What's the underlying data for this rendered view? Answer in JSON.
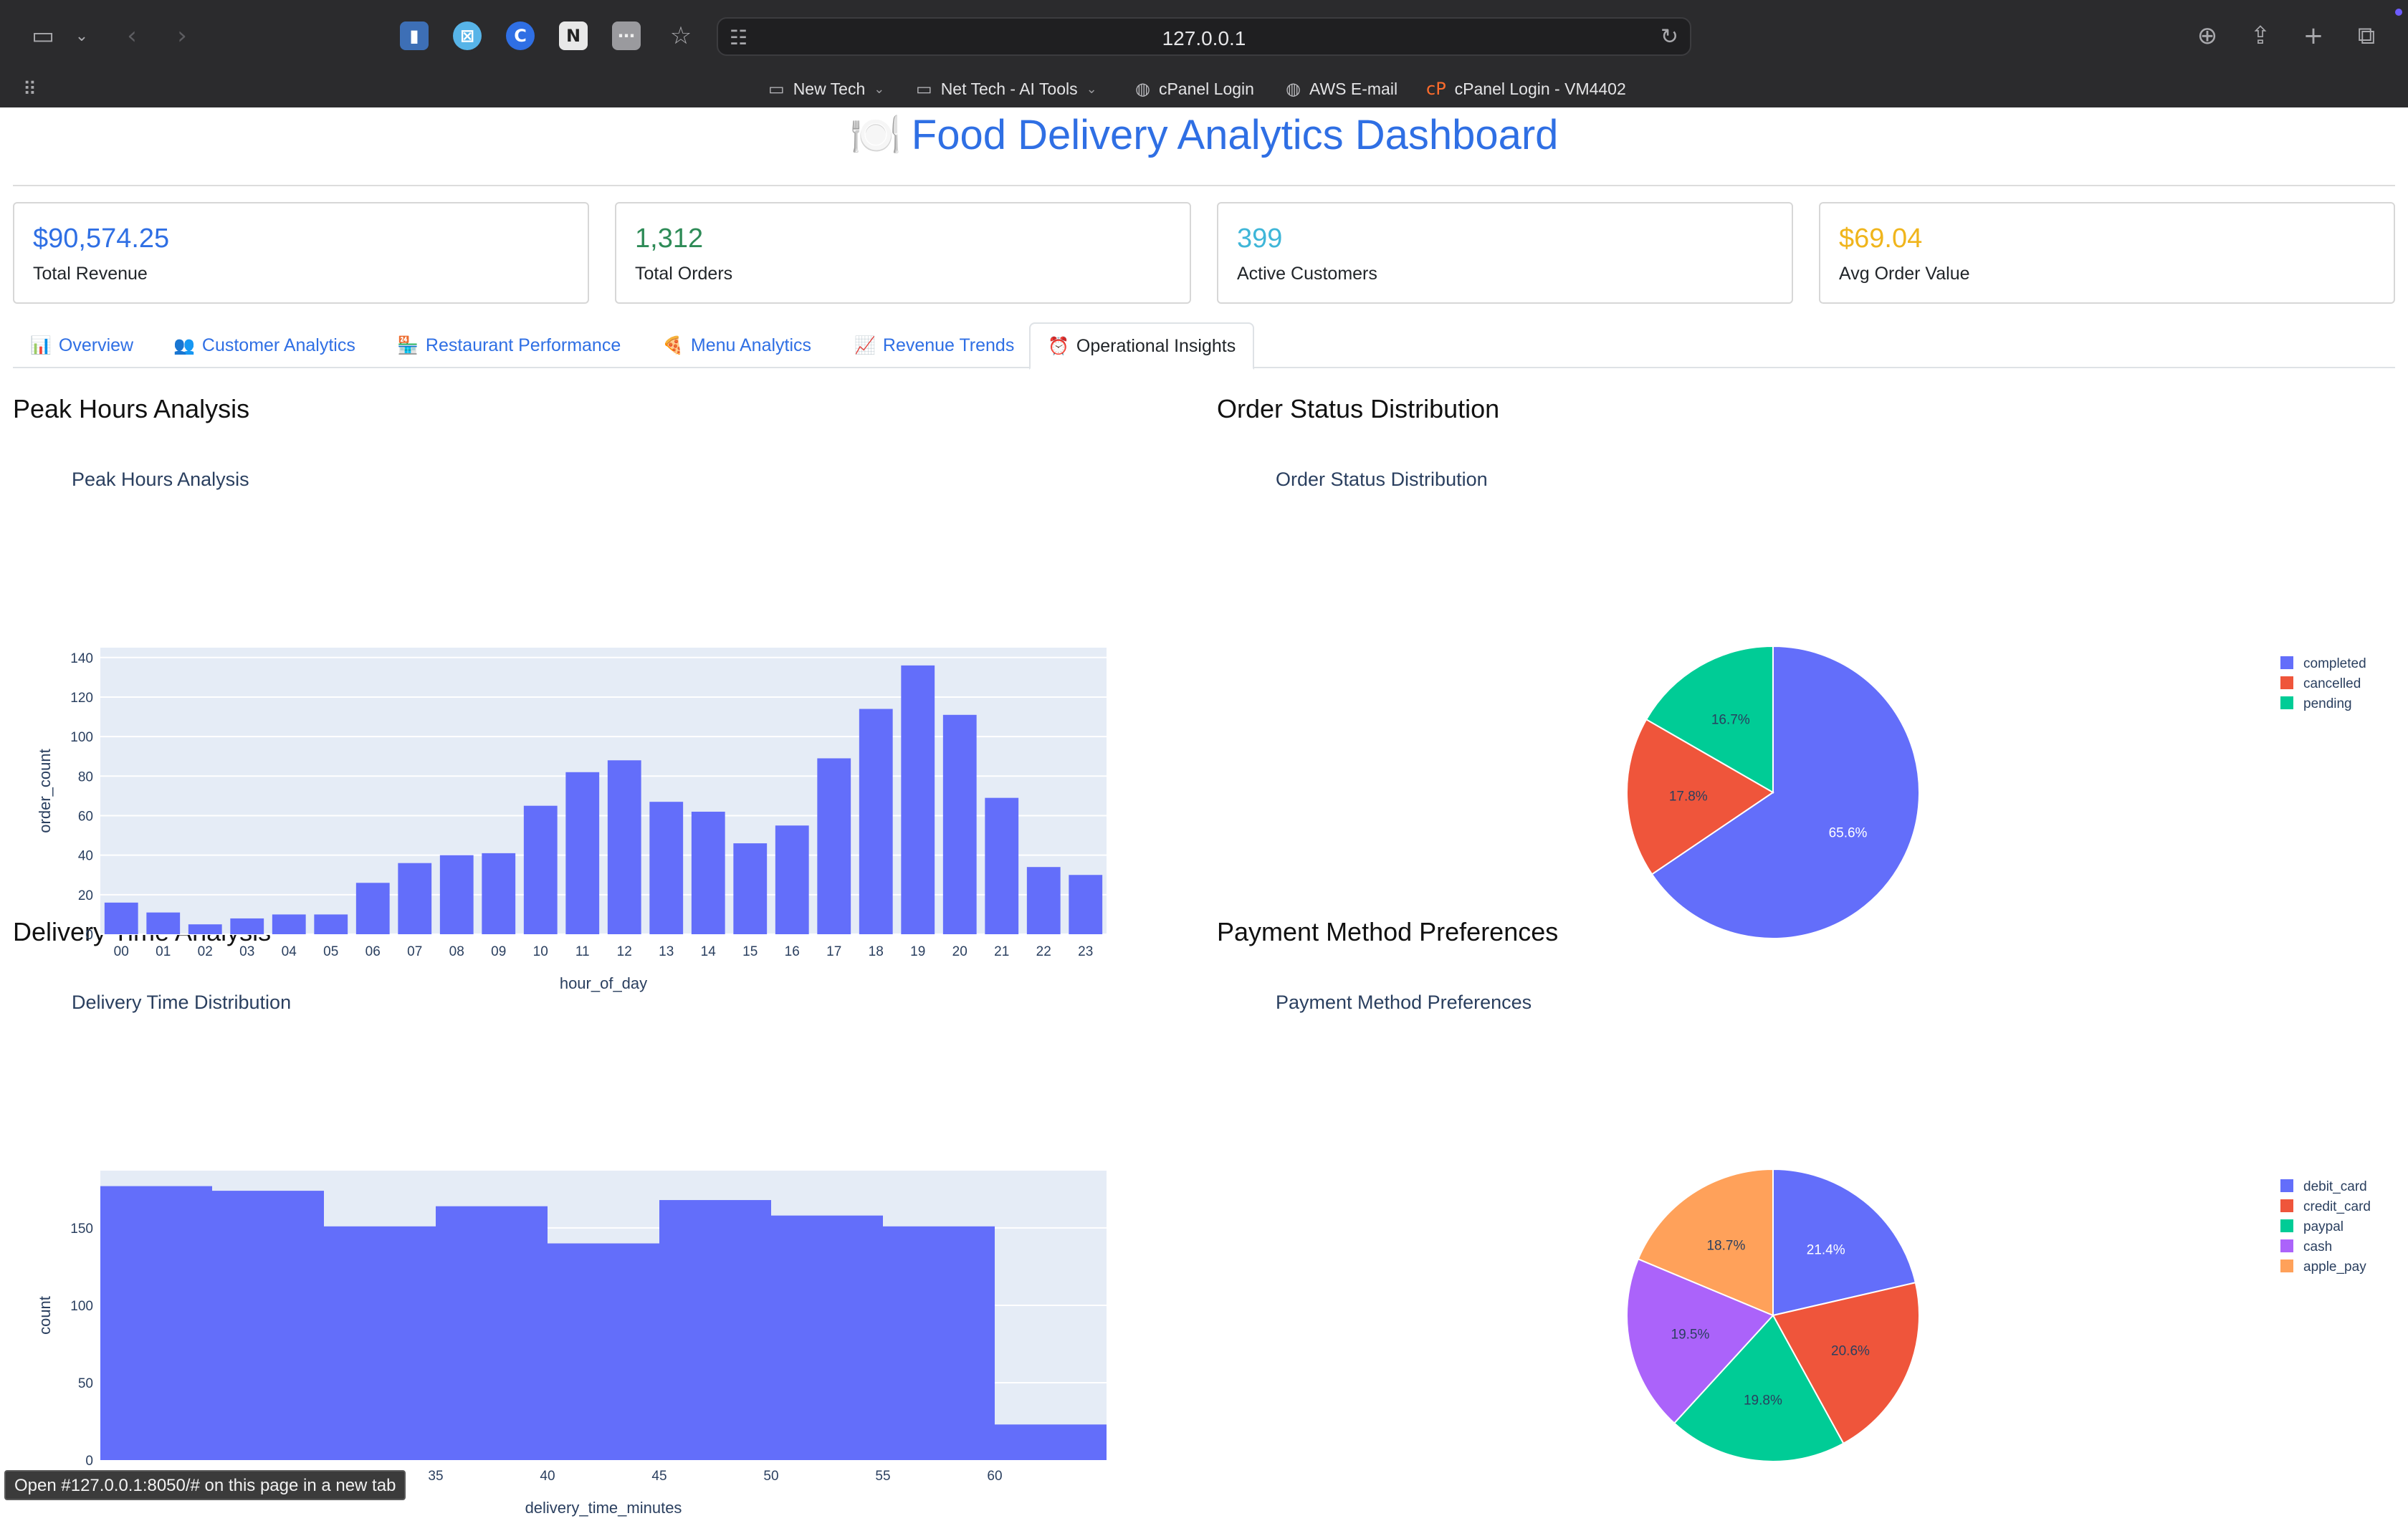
{
  "browser": {
    "url": "127.0.0.1",
    "bookmarks": [
      {
        "label": "New Tech",
        "icon": "folder-icon",
        "has_menu": true
      },
      {
        "label": "Net Tech - AI Tools",
        "icon": "folder-icon",
        "has_menu": true
      },
      {
        "label": "cPanel Login",
        "icon": "globe-icon",
        "has_menu": false
      },
      {
        "label": "AWS E-mail",
        "icon": "globe-icon",
        "has_menu": false
      },
      {
        "label": "cPanel Login - VM4402",
        "icon": "cpanel-icon",
        "has_menu": false
      }
    ]
  },
  "header": {
    "icon": "🍽️",
    "title": "Food Delivery Analytics Dashboard"
  },
  "kpis": [
    {
      "value": "$90,574.25",
      "label": "Total Revenue",
      "color": "#2f6fe4"
    },
    {
      "value": "1,312",
      "label": "Total Orders",
      "color": "#2e8b57"
    },
    {
      "value": "399",
      "label": "Active Customers",
      "color": "#3fb6d8"
    },
    {
      "value": "$69.04",
      "label": "Avg Order Value",
      "color": "#f0b51c"
    }
  ],
  "tabs": [
    {
      "icon": "📊",
      "label": "Overview",
      "active": false
    },
    {
      "icon": "👥",
      "label": "Customer Analytics",
      "active": false
    },
    {
      "icon": "🏪",
      "label": "Restaurant Performance",
      "active": false
    },
    {
      "icon": "🍕",
      "label": "Menu Analytics",
      "active": false
    },
    {
      "icon": "📈",
      "label": "Revenue Trends",
      "active": false
    },
    {
      "icon": "⏰",
      "label": "Operational Insights",
      "active": true
    }
  ],
  "sections": {
    "peak": {
      "heading": "Peak Hours Analysis",
      "chart_title": "Peak Hours Analysis"
    },
    "status": {
      "heading": "Order Status Distribution",
      "chart_title": "Order Status Distribution"
    },
    "delivery": {
      "heading": "Delivery Time Analysis",
      "chart_title": "Delivery Time Distribution"
    },
    "payment": {
      "heading": "Payment Method Preferences",
      "chart_title": "Payment Method Preferences"
    }
  },
  "status_tip": "Open #127.0.0.1:8050/# on this page in a new tab",
  "chart_data": [
    {
      "type": "bar",
      "title": "Peak Hours Analysis",
      "xlabel": "hour_of_day",
      "ylabel": "order_count",
      "categories": [
        "00",
        "01",
        "02",
        "03",
        "04",
        "05",
        "06",
        "07",
        "08",
        "09",
        "10",
        "11",
        "12",
        "13",
        "14",
        "15",
        "16",
        "17",
        "18",
        "19",
        "20",
        "21",
        "22",
        "23"
      ],
      "values": [
        16,
        11,
        5,
        8,
        10,
        10,
        26,
        36,
        40,
        41,
        65,
        82,
        88,
        67,
        62,
        46,
        55,
        89,
        114,
        136,
        111,
        69,
        34,
        30
      ],
      "ylim": [
        0,
        145
      ],
      "yticks": [
        0,
        20,
        40,
        60,
        80,
        100,
        120,
        140
      ],
      "color": "#636efa",
      "grid": true
    },
    {
      "type": "pie",
      "title": "Order Status Distribution",
      "labels": [
        "completed",
        "cancelled",
        "pending"
      ],
      "values": [
        65.6,
        17.8,
        16.7
      ],
      "colors": [
        "#636efa",
        "#ef553b",
        "#00cc96"
      ],
      "legend": "top-right"
    },
    {
      "type": "bar",
      "title": "Delivery Time Distribution",
      "xlabel": "delivery_time_minutes",
      "ylabel": "count",
      "bins": [
        {
          "start": 20,
          "end": 25,
          "count": 177
        },
        {
          "start": 25,
          "end": 30,
          "count": 174
        },
        {
          "start": 30,
          "end": 35,
          "count": 151
        },
        {
          "start": 35,
          "end": 40,
          "count": 164
        },
        {
          "start": 40,
          "end": 45,
          "count": 140
        },
        {
          "start": 45,
          "end": 50,
          "count": 168
        },
        {
          "start": 50,
          "end": 55,
          "count": 158
        },
        {
          "start": 55,
          "end": 60,
          "count": 151
        },
        {
          "start": 60,
          "end": 65,
          "count": 23
        }
      ],
      "xlim": [
        20,
        65
      ],
      "ylim": [
        0,
        187
      ],
      "xticks": [
        20,
        25,
        30,
        35,
        40,
        45,
        50,
        55,
        60
      ],
      "yticks": [
        0,
        50,
        100,
        150
      ],
      "color": "#636efa",
      "grid": true
    },
    {
      "type": "pie",
      "title": "Payment Method Preferences",
      "labels": [
        "debit_card",
        "credit_card",
        "paypal",
        "cash",
        "apple_pay"
      ],
      "values": [
        21.4,
        20.6,
        19.8,
        19.5,
        18.7
      ],
      "colors": [
        "#636efa",
        "#ef553b",
        "#00cc96",
        "#ab63fa",
        "#ffa15a"
      ],
      "legend": "top-right"
    }
  ]
}
